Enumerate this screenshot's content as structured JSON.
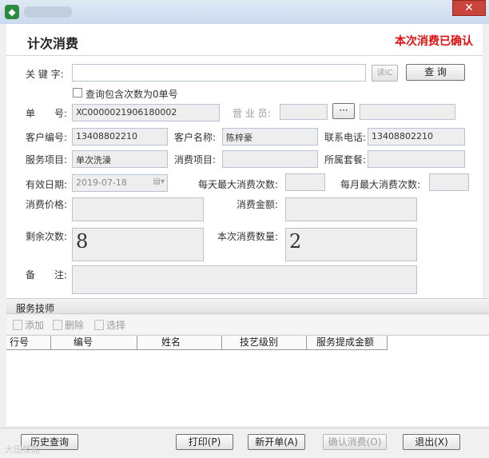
{
  "window": {
    "close_label": "✕"
  },
  "header": {
    "title": "计次消费",
    "status": "本次消费已确认"
  },
  "form": {
    "keyword_label": "关 键 字:",
    "keyword_value": "",
    "read_ic_label": "读IC",
    "query_label": "查 询",
    "include_zero_label": "查询包含次数为0单号",
    "order_no_label": "单　　号:",
    "order_no_value": "XC0000021906180002",
    "staff_label": "营 业 员:",
    "staff_value": "",
    "ellipsis_label": "···",
    "staff_extra_value": "",
    "customer_no_label": "客户编号:",
    "customer_no_value": "13408802210",
    "customer_name_label": "客户名称:",
    "customer_name_value": "陈梓豪",
    "phone_label": "联系电话:",
    "phone_value": "13408802210",
    "service_item_label": "服务项目:",
    "service_item_value": "单次洗澡",
    "consume_item_label": "消费项目:",
    "consume_item_value": "",
    "package_label": "所属套餐:",
    "package_value": "",
    "valid_date_label": "有效日期:",
    "valid_date_value": "2019-07-18",
    "daily_max_label": "每天最大消费次数:",
    "daily_max_value": "",
    "monthly_max_label": "每月最大消费次数:",
    "monthly_max_value": "",
    "price_label": "消费价格:",
    "price_value": "",
    "amount_label": "消费金额:",
    "amount_value": "",
    "remaining_label": "剩余次数:",
    "remaining_value": "8",
    "this_qty_label": "本次消费数量:",
    "this_qty_value": "2",
    "remark_label": "备　　注:",
    "remark_value": ""
  },
  "technicians": {
    "section_title": "服务技师",
    "add_label": "添加",
    "delete_label": "删除",
    "select_label": "选择",
    "columns": [
      "行号",
      "编号",
      "姓名",
      "技艺级别",
      "服务提成金额"
    ]
  },
  "footer": {
    "history_label": "历史查询",
    "print_label": "打印(P)",
    "new_label": "新开单(A)",
    "confirm_label": "确认消费(O)",
    "exit_label": "退出(X)",
    "watermark": "大田技能"
  }
}
